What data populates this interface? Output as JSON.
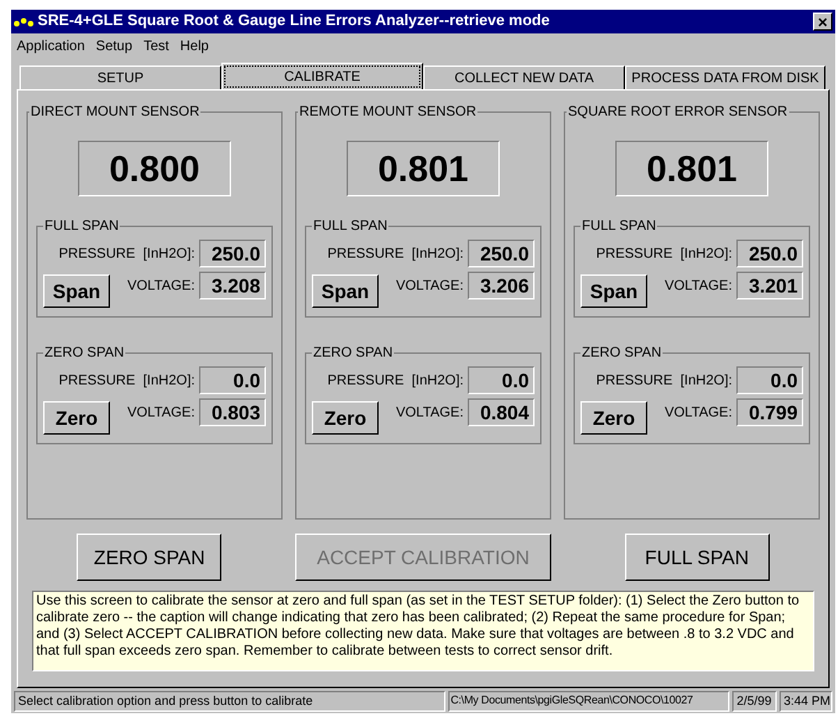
{
  "window": {
    "title": "SRE-4+GLE Square Root & Gauge Line Errors Analyzer--retrieve mode",
    "close": "×"
  },
  "menu": [
    "Application",
    "Setup",
    "Test",
    "Help"
  ],
  "tabs": [
    {
      "label": "SETUP",
      "selected": false
    },
    {
      "label": "CALIBRATE",
      "selected": true
    },
    {
      "label": "COLLECT NEW DATA",
      "selected": false
    },
    {
      "label": "PROCESS DATA FROM DISK",
      "selected": false
    }
  ],
  "sensors": [
    {
      "title": "DIRECT MOUNT SENSOR",
      "reading": "0.800",
      "full_span": {
        "title": "FULL SPAN",
        "pressure_label": "PRESSURE  [InH2O]:",
        "pressure": "250.0",
        "voltage_label": "VOLTAGE:",
        "voltage": "3.208",
        "button": "Span"
      },
      "zero_span": {
        "title": "ZERO SPAN",
        "pressure_label": "PRESSURE  [InH2O]:",
        "pressure": "0.0",
        "voltage_label": "VOLTAGE:",
        "voltage": "0.803",
        "button": "Zero"
      }
    },
    {
      "title": "REMOTE MOUNT SENSOR",
      "reading": "0.801",
      "full_span": {
        "title": "FULL SPAN",
        "pressure_label": "PRESSURE  [InH2O]:",
        "pressure": "250.0",
        "voltage_label": "VOLTAGE:",
        "voltage": "3.206",
        "button": "Span"
      },
      "zero_span": {
        "title": "ZERO SPAN",
        "pressure_label": "PRESSURE  [InH2O]:",
        "pressure": "0.0",
        "voltage_label": "VOLTAGE:",
        "voltage": "0.804",
        "button": "Zero"
      }
    },
    {
      "title": "SQUARE ROOT ERROR SENSOR",
      "reading": "0.801",
      "full_span": {
        "title": "FULL SPAN",
        "pressure_label": "PRESSURE  [InH2O]:",
        "pressure": "250.0",
        "voltage_label": "VOLTAGE:",
        "voltage": "3.201",
        "button": "Span"
      },
      "zero_span": {
        "title": "ZERO SPAN",
        "pressure_label": "PRESSURE  [InH2O]:",
        "pressure": "0.0",
        "voltage_label": "VOLTAGE:",
        "voltage": "0.799",
        "button": "Zero"
      }
    }
  ],
  "actions": [
    {
      "label": "ZERO SPAN",
      "disabled": false
    },
    {
      "label": "ACCEPT CALIBRATION",
      "disabled": true
    },
    {
      "label": "FULL SPAN",
      "disabled": false
    }
  ],
  "help_text": "Use this screen to calibrate the sensor at zero and full span (as set in the TEST SETUP folder):  (1) Select the Zero button to calibrate zero -- the caption will change indicating that zero has been calibrated; (2) Repeat the same procedure for Span; and (3) Select ACCEPT CALIBRATION before collecting new data.  Make sure that voltages are between .8 to 3.2 VDC and that full span exceeds zero span.  Remember to calibrate between tests to correct sensor drift.",
  "status_bar": {
    "message": "Select calibration option and press button to calibrate",
    "path": "C:\\My Documents\\pgiGleSQRean\\CONOCO\\10027",
    "date": "2/5/99",
    "time": "3:44 PM"
  }
}
